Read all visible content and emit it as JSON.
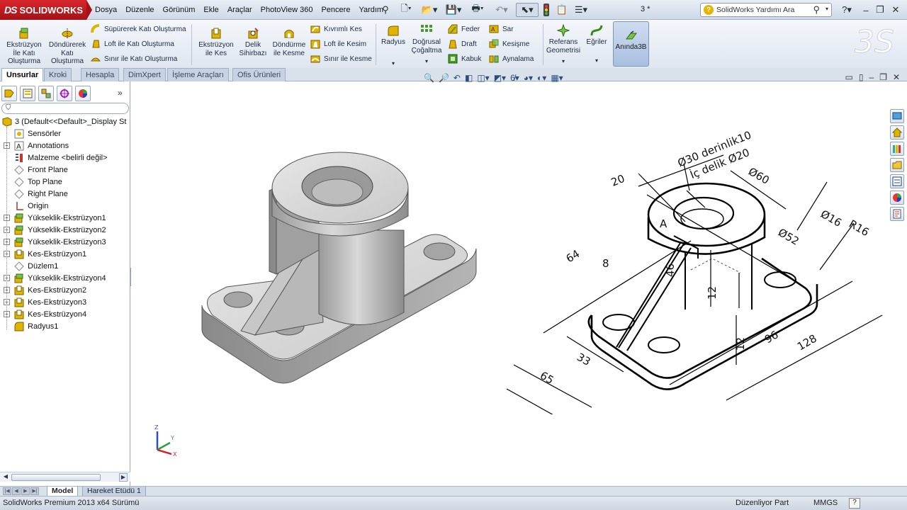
{
  "app": {
    "logo_text": "SOLIDWORKS",
    "logo_mark": "DS",
    "doc_title": "3 *"
  },
  "menu": [
    "Dosya",
    "Düzenle",
    "Görünüm",
    "Ekle",
    "Araçlar",
    "PhotoView 360",
    "Pencere",
    "Yardım"
  ],
  "help_search": {
    "placeholder": "SolidWorks Yardımı Ara"
  },
  "ribbon": {
    "extrude_boss": "Ekstrüzyon İle Katı Oluşturma",
    "revolve_boss": "Döndürerek Katı Oluşturma",
    "sweep_boss": "Süpürerek Katı Oluşturma",
    "loft_boss": "Loft ile Katı Oluşturma",
    "boundary_boss": "Sınır ile Katı Oluşturma",
    "extrude_cut": "Ekstrüzyon ile Kes",
    "hole_wizard": "Delik Sihirbazı",
    "revolve_cut": "Döndürme ile Kesme",
    "swept_cut": "Kıvrımlı Kes",
    "loft_cut": "Loft ile Kesim",
    "boundary_cut": "Sınır ile Kesme",
    "fillet": "Radyus",
    "linear_pattern": "Doğrusal Çoğaltma",
    "rib": "Feder",
    "draft": "Draft",
    "shell": "Kabuk",
    "wrap": "Sar",
    "intersect": "Kesişme",
    "mirror": "Aynalama",
    "ref_geometry": "Referans Geometrisi",
    "curves": "Eğriler",
    "instant3d": "Anında3B"
  },
  "command_tabs": [
    "Unsurlar",
    "Kroki",
    "Hesapla",
    "DimXpert",
    "İşleme Araçları",
    "Ofis Ürünleri"
  ],
  "tree": {
    "root": "3  (Default<<Default>_Display St",
    "items": [
      {
        "label": "Sensörler",
        "icon": "sensor-icon",
        "expand": false
      },
      {
        "label": "Annotations",
        "icon": "annotation-icon",
        "expand": true
      },
      {
        "label": "Malzeme <belirli değil>",
        "icon": "material-icon",
        "expand": false
      },
      {
        "label": "Front Plane",
        "icon": "plane-icon",
        "expand": false
      },
      {
        "label": "Top Plane",
        "icon": "plane-icon",
        "expand": false
      },
      {
        "label": "Right Plane",
        "icon": "plane-icon",
        "expand": false
      },
      {
        "label": "Origin",
        "icon": "origin-icon",
        "expand": false
      },
      {
        "label": "Yükseklik-Ekstrüzyon1",
        "icon": "extrude-icon",
        "expand": true
      },
      {
        "label": "Yükseklik-Ekstrüzyon2",
        "icon": "extrude-icon",
        "expand": true
      },
      {
        "label": "Yükseklik-Ekstrüzyon3",
        "icon": "extrude-icon",
        "expand": true
      },
      {
        "label": "Kes-Ekstrüzyon1",
        "icon": "cut-icon",
        "expand": true
      },
      {
        "label": "Düzlem1",
        "icon": "plane-icon",
        "expand": false
      },
      {
        "label": "Yükseklik-Ekstrüzyon4",
        "icon": "extrude-icon",
        "expand": true
      },
      {
        "label": "Kes-Ekstrüzyon2",
        "icon": "cut-icon",
        "expand": true
      },
      {
        "label": "Kes-Ekstrüzyon3",
        "icon": "cut-icon",
        "expand": true
      },
      {
        "label": "Kes-Ekstrüzyon4",
        "icon": "cut-icon",
        "expand": true
      },
      {
        "label": "Radyus1",
        "icon": "fillet-icon",
        "expand": false
      }
    ]
  },
  "drawing": {
    "callout_1": "Ø30 derinlik10",
    "callout_2": "İç delik Ø20",
    "dims": {
      "d20": "20",
      "d60": "Ø60",
      "d16": "Ø16",
      "r16": "R16",
      "d52": "Ø52",
      "d64": "64",
      "d8": "8",
      "d46": "46",
      "d12a": "12",
      "d12b": "12",
      "d96": "96",
      "d128": "128",
      "d33": "33",
      "d65": "65",
      "label_a": "A"
    }
  },
  "axes": {
    "x": "X",
    "y": "Y",
    "z": "Z"
  },
  "model_tabs": [
    "Model",
    "Hareket Etüdü 1"
  ],
  "status": {
    "version": "SolidWorks Premium 2013 x64 Sürümü",
    "mode": "Düzenliyor Part",
    "units": "MMGS",
    "help": "?"
  }
}
